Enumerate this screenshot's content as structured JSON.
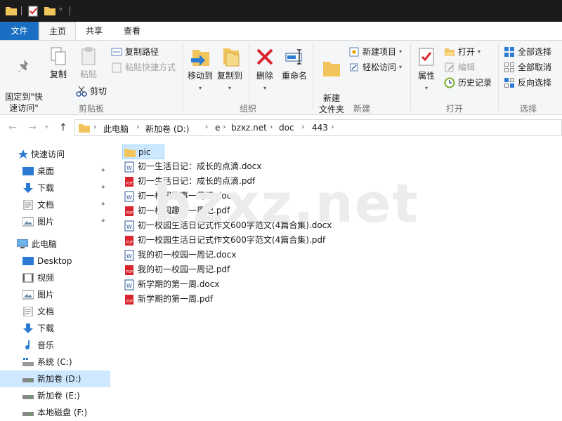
{
  "tabs": {
    "file": "文件",
    "home": "主页",
    "share": "共享",
    "view": "查看"
  },
  "ribbon": {
    "clipboard": {
      "label": "剪贴板",
      "pin_quick": "固定到\"快\n速访问\"",
      "copy": "复制",
      "paste": "粘贴",
      "copy_path": "复制路径",
      "paste_shortcut": "粘贴快捷方式",
      "cut": "剪切"
    },
    "organize": {
      "label": "组织",
      "move_to": "移动到",
      "copy_to": "复制到",
      "delete": "删除",
      "rename": "重命名"
    },
    "new": {
      "label": "新建",
      "new_folder": "新建\n文件夹",
      "new_item": "新建项目",
      "easy_access": "轻松访问"
    },
    "open": {
      "label": "打开",
      "properties": "属性",
      "open": "打开",
      "edit": "编辑",
      "history": "历史记录"
    },
    "select": {
      "label": "选择",
      "select_all": "全部选择",
      "select_none": "全部取消",
      "invert": "反向选择"
    }
  },
  "breadcrumb": [
    "此电脑",
    "新加卷 (D:)",
    "e",
    "bzxz.net",
    "doc",
    "443"
  ],
  "navpane": {
    "quick_access": "快速访问",
    "quick_items": [
      "桌面",
      "下载",
      "文档",
      "图片"
    ],
    "this_pc": "此电脑",
    "pc_items": [
      "Desktop",
      "视频",
      "图片",
      "文档",
      "下载",
      "音乐",
      "系统 (C:)",
      "新加卷 (D:)",
      "新加卷 (E:)",
      "本地磁盘 (F:)"
    ]
  },
  "files": [
    {
      "name": "pic",
      "type": "folder"
    },
    {
      "name": "初一生活日记：成长的点滴.docx",
      "type": "docx"
    },
    {
      "name": "初一生活日记：成长的点滴.pdf",
      "type": "pdf"
    },
    {
      "name": "初一校园趣事一周记.docx",
      "type": "docx"
    },
    {
      "name": "初一校园趣事一周记.pdf",
      "type": "pdf"
    },
    {
      "name": "初一校园生活日记式作文600字范文(4篇合集).docx",
      "type": "docx"
    },
    {
      "name": "初一校园生活日记式作文600字范文(4篇合集).pdf",
      "type": "pdf"
    },
    {
      "name": "我的初一校园一周记.docx",
      "type": "docx"
    },
    {
      "name": "我的初一校园一周记.pdf",
      "type": "pdf"
    },
    {
      "name": "新学期的第一周.docx",
      "type": "docx"
    },
    {
      "name": "新学期的第一周.pdf",
      "type": "pdf"
    }
  ],
  "watermark": "bzxz.net",
  "colors": {
    "accent": "#1a6fc4",
    "selection": "#cce8ff",
    "folder": "#f2c55c",
    "pdf": "#d9262e",
    "word": "#2b579a"
  }
}
